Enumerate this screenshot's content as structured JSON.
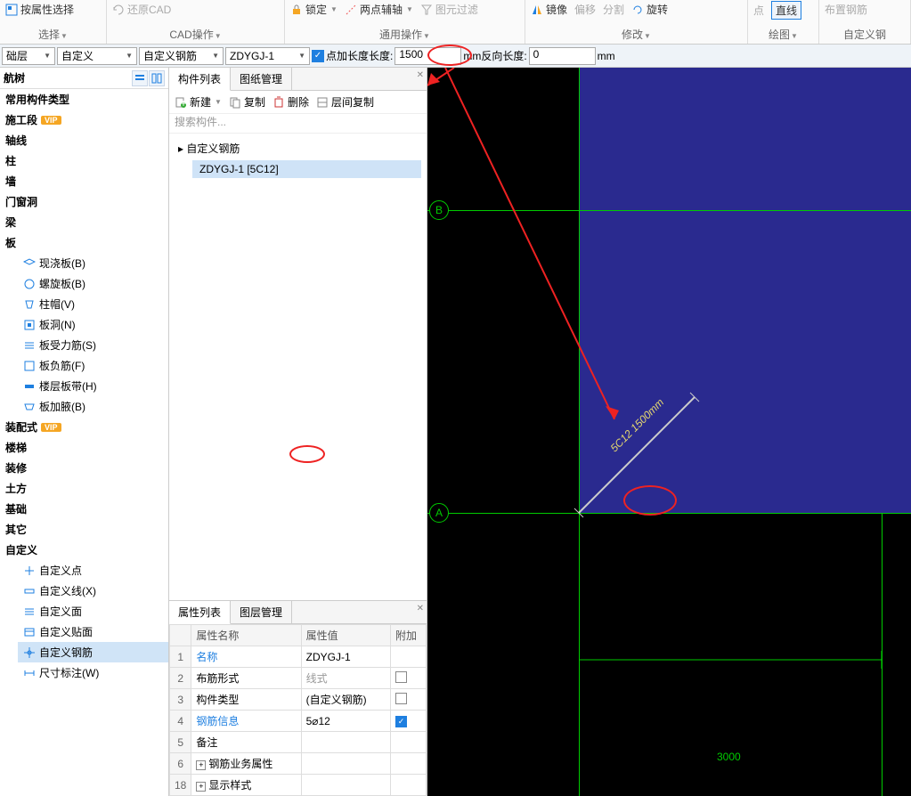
{
  "ribbon": {
    "select_group": {
      "by_property": "按属性选择",
      "label": "选择",
      "dropdown": "选择"
    },
    "cad_group": {
      "restore_cad": "还原CAD",
      "label": "CAD操作"
    },
    "common_group": {
      "lock": "锁定",
      "two_axis": "两点辅轴",
      "filter": "图元过滤",
      "label": "通用操作"
    },
    "modify_group": {
      "mirror": "镜像",
      "offset": "偏移",
      "split": "分割",
      "rotate": "旋转",
      "label": "修改"
    },
    "draw_group": {
      "point": "点",
      "line": "直线",
      "label": "绘图",
      "custom_rebar": "自定义钢",
      "rebar_place": "布置钢筋"
    }
  },
  "toolbar2": {
    "floor": "础层",
    "custom": "自定义",
    "custom_rebar": "自定义钢筋",
    "component": "ZDYGJ-1",
    "length_label": "点加长度长度:",
    "length_value": "1500",
    "mm_reverse": "mm反向长度:",
    "reverse_value": "0",
    "mm": "mm"
  },
  "nav": {
    "title": "航树",
    "items": {
      "common": "常用构件类型",
      "construction": "施工段",
      "axis": "轴线",
      "column": "柱",
      "wall": "墙",
      "door_window": "门窗洞",
      "beam": "梁",
      "slab": "板",
      "slab_children": {
        "cast_slab": "现浇板(B)",
        "spiral_slab": "螺旋板(B)",
        "column_cap": "柱帽(V)",
        "slab_hole": "板洞(N)",
        "slab_rebar": "板受力筋(S)",
        "slab_neg": "板负筋(F)",
        "floor_band": "楼层板带(H)",
        "add_haunch": "板加腋(B)"
      },
      "assembly": "装配式",
      "stair": "楼梯",
      "decoration": "装修",
      "earthwork": "土方",
      "foundation": "基础",
      "other": "其它",
      "custom": "自定义",
      "custom_children": {
        "custom_point": "自定义点",
        "custom_line": "自定义线(X)",
        "custom_face": "自定义面",
        "custom_paste": "自定义贴面",
        "custom_rebar": "自定义钢筋",
        "dimension": "尺寸标注(W)"
      }
    }
  },
  "mid": {
    "tabs": {
      "component_list": "构件列表",
      "drawing_mgmt": "图纸管理"
    },
    "toolbar": {
      "new": "新建",
      "copy": "复制",
      "delete": "删除",
      "floor_copy": "层间复制"
    },
    "search_placeholder": "搜索构件...",
    "tree": {
      "parent": "自定义钢筋",
      "child": "ZDYGJ-1 [5C12]"
    }
  },
  "props": {
    "tabs": {
      "prop_list": "属性列表",
      "layer_mgmt": "图层管理"
    },
    "headers": {
      "name": "属性名称",
      "value": "属性值",
      "extra": "附加"
    },
    "rows": [
      {
        "n": "1",
        "name": "名称",
        "value": "ZDYGJ-1",
        "link": true
      },
      {
        "n": "2",
        "name": "布筋形式",
        "value": "线式",
        "gray": true,
        "cb": false
      },
      {
        "n": "3",
        "name": "构件类型",
        "value": "(自定义钢筋)",
        "cb": false
      },
      {
        "n": "4",
        "name": "钢筋信息",
        "value": "5⌀12",
        "link": true,
        "cb": true
      },
      {
        "n": "5",
        "name": "备注",
        "value": ""
      },
      {
        "n": "6",
        "name": "钢筋业务属性",
        "value": "",
        "expand": true
      },
      {
        "n": "18",
        "name": "显示样式",
        "value": "",
        "expand": true
      }
    ]
  },
  "canvas": {
    "axis_b": "B",
    "axis_a": "A",
    "rebar_label": "5C12  1500mm",
    "dim_3000": "3000"
  }
}
